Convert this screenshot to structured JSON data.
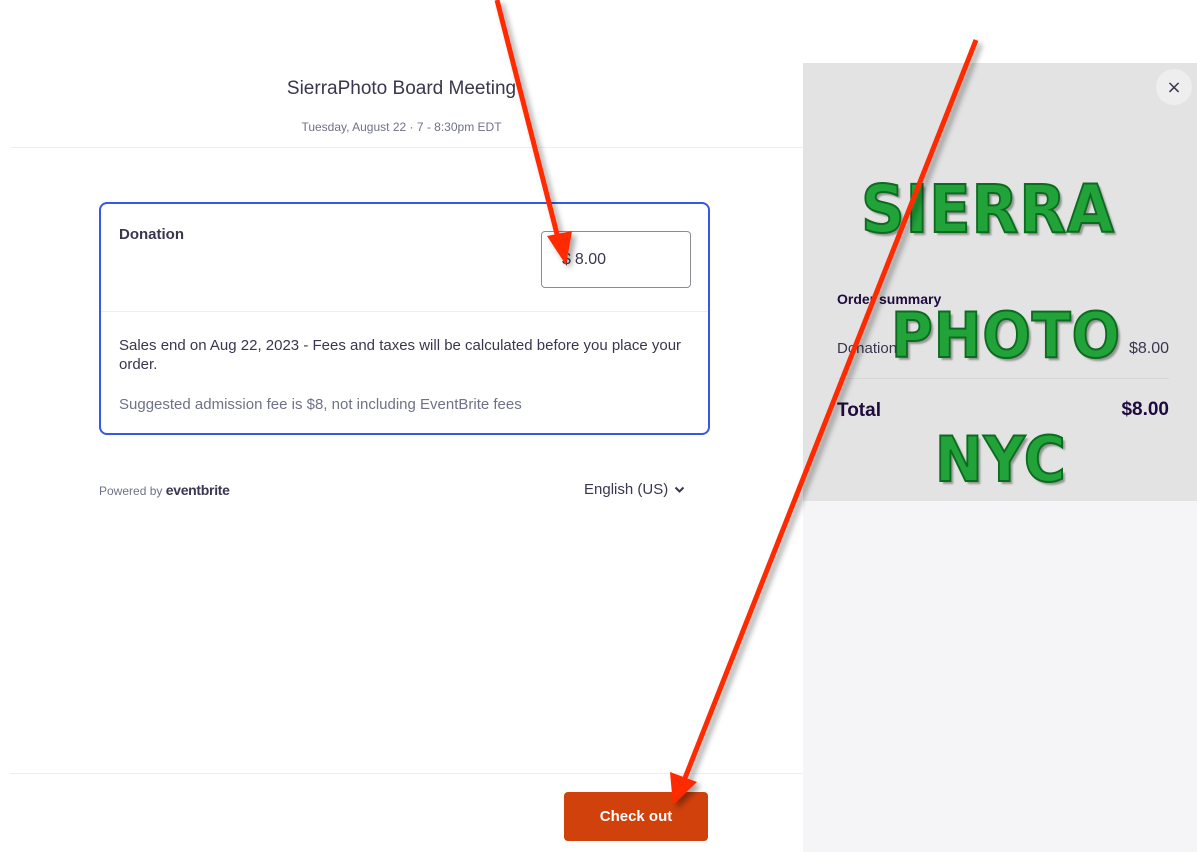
{
  "event": {
    "title": "SierraPhoto Board Meeting",
    "date": "Tuesday, August 22 · 7 - 8:30pm EDT"
  },
  "ticket": {
    "name": "Donation",
    "currency_symbol": "$",
    "amount": "8.00",
    "sales_text": "Sales end on Aug 22, 2023 - Fees and taxes will be calculated before you place your order.",
    "suggestion": "Suggested admission fee is $8, not including EventBrite fees"
  },
  "footer": {
    "powered_by": "Powered by",
    "brand": "eventbrite",
    "language": "English (US)",
    "checkout_label": "Check out"
  },
  "summary": {
    "logo_words": [
      "SIERRA",
      "PHOTO",
      "NYC"
    ],
    "title": "Order summary",
    "line_label": "Donation",
    "line_value": "$8.00",
    "total_label": "Total",
    "total_value": "$8.00",
    "close_glyph": "×"
  },
  "colors": {
    "accent_border": "#3659e3",
    "checkout": "#d1410c",
    "annotation_arrow": "#ff2a00",
    "logo_green": "#21a33a"
  },
  "icons": [
    "chevron-down-icon",
    "close-icon",
    "annotation-arrow"
  ]
}
